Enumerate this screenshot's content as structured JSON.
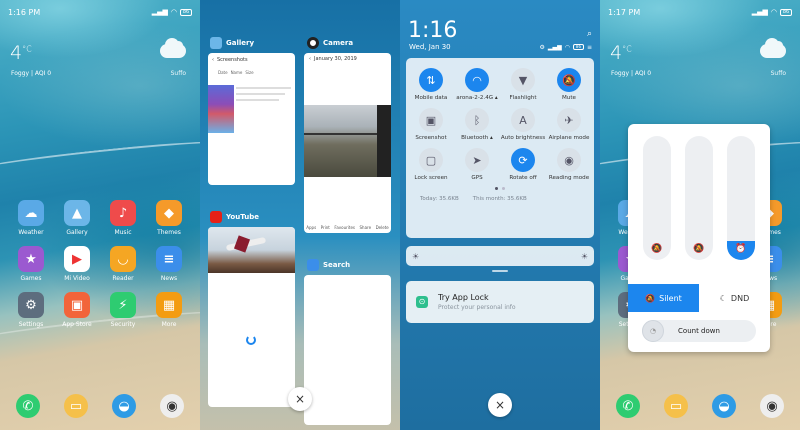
{
  "status": {
    "time1": "1:16 PM",
    "time4": "1:17 PM",
    "battery": "86"
  },
  "weather": {
    "temp": "4",
    "unit": "°C",
    "desc": "Foggy | AQI 0",
    "right": "Suffo"
  },
  "home_apps": [
    {
      "label": "Weather",
      "color": "#5aa9e6",
      "glyph": "☁"
    },
    {
      "label": "Gallery",
      "color": "#6cb6e8",
      "glyph": "▲"
    },
    {
      "label": "Music",
      "color": "#ef4b4b",
      "glyph": "♪"
    },
    {
      "label": "Themes",
      "color": "#f59a2a",
      "glyph": "◆"
    },
    {
      "label": "Games",
      "color": "#9b59d0",
      "glyph": "★"
    },
    {
      "label": "Mi Video",
      "color": "#ffffff",
      "glyph": "▶"
    },
    {
      "label": "Reader",
      "color": "#f5a623",
      "glyph": "◡"
    },
    {
      "label": "News",
      "color": "#3b8eea",
      "glyph": "≡"
    },
    {
      "label": "Settings",
      "color": "#5d6d7e",
      "glyph": "⚙"
    },
    {
      "label": "App Store",
      "color": "#f2643a",
      "glyph": "▣"
    },
    {
      "label": "Security",
      "color": "#2ecc71",
      "glyph": "⚡"
    },
    {
      "label": "More",
      "color": "#f39c12",
      "glyph": "▦"
    }
  ],
  "dock": [
    {
      "name": "phone",
      "color": "#2ecc71",
      "glyph": "✆"
    },
    {
      "name": "messages",
      "color": "#f5c04a",
      "glyph": "▭"
    },
    {
      "name": "browser",
      "color": "#2e9be5",
      "glyph": "◒"
    },
    {
      "name": "camera",
      "color": "#333",
      "glyph": "◉"
    }
  ],
  "recents": {
    "gallery": {
      "title": "Gallery",
      "screen_title": "Screenshots",
      "tabs": [
        "Date",
        "Name",
        "Size"
      ]
    },
    "camera": {
      "title": "Camera",
      "date": "January 30, 2019",
      "tabs": [
        "Apps",
        "Print",
        "Favourites",
        "Share",
        "Delete"
      ]
    },
    "youtube": {
      "title": "YouTube"
    },
    "search": {
      "title": "Search"
    },
    "close": "×"
  },
  "qs": {
    "time": "1:16",
    "date": "Wed, Jan 30",
    "tiles": [
      {
        "label": "Mobile data",
        "on": true,
        "glyph": "⇅"
      },
      {
        "label": "arona-2-2.4G ▴",
        "on": true,
        "glyph": "◠"
      },
      {
        "label": "Flashlight",
        "on": false,
        "glyph": "▼"
      },
      {
        "label": "Mute",
        "on": true,
        "glyph": "🔕"
      },
      {
        "label": "Screenshot",
        "on": false,
        "glyph": "▣"
      },
      {
        "label": "Bluetooth ▴",
        "on": false,
        "glyph": "ᛒ"
      },
      {
        "label": "Auto brightness",
        "on": false,
        "glyph": "A"
      },
      {
        "label": "Airplane mode",
        "on": false,
        "glyph": "✈"
      },
      {
        "label": "Lock screen",
        "on": false,
        "glyph": "▢"
      },
      {
        "label": "GPS",
        "on": false,
        "glyph": "➤"
      },
      {
        "label": "Rotate off",
        "on": true,
        "glyph": "⟳"
      },
      {
        "label": "Reading mode",
        "on": false,
        "glyph": "◉"
      }
    ],
    "usage_today": "Today: 35.6KB",
    "usage_month": "This month: 35.6KB",
    "notif_title": "Try App Lock",
    "notif_text": "Protect your personal info"
  },
  "volume": {
    "levels": [
      0,
      0,
      0.15
    ],
    "silent": "Silent",
    "dnd": "DND",
    "countdown": "Count down"
  },
  "colors": {
    "accent": "#1c86ee"
  }
}
